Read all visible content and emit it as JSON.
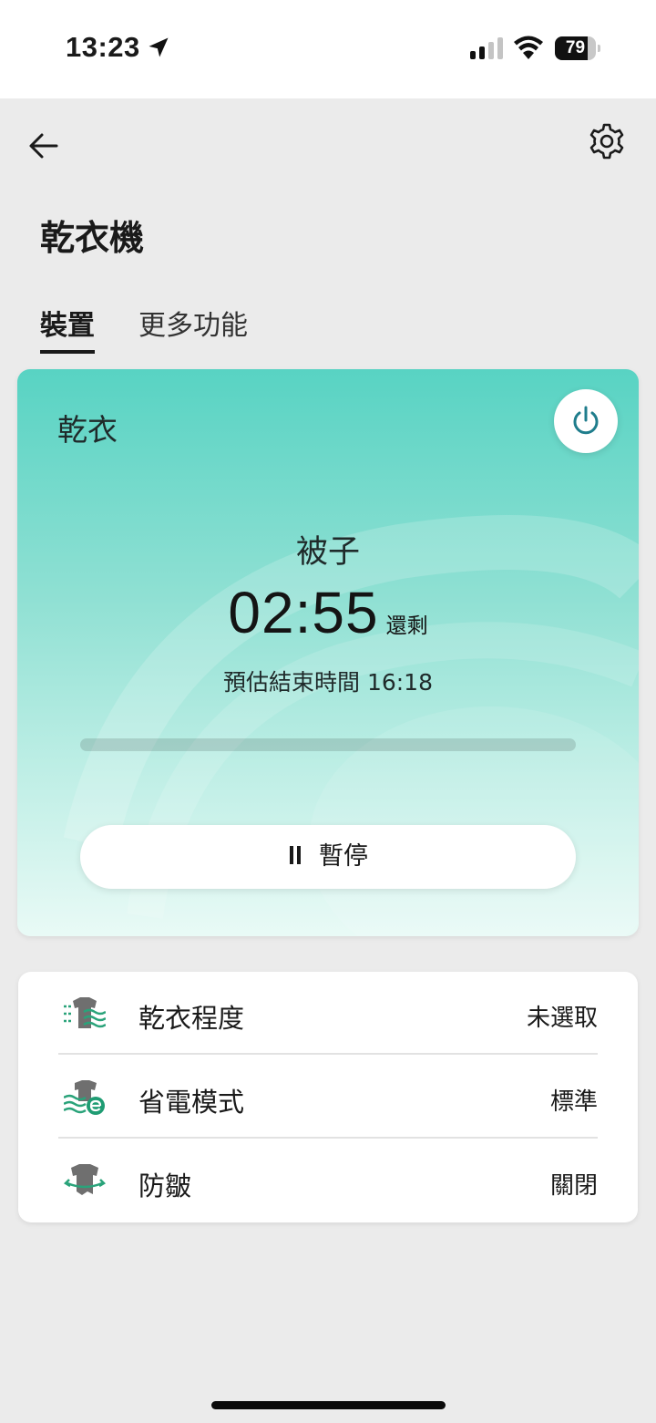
{
  "status_bar": {
    "time": "13:23",
    "battery_level": "79",
    "battery_fraction": 0.79
  },
  "header": {
    "title": "乾衣機",
    "back_icon": "arrow-left-icon",
    "settings_icon": "gear-icon"
  },
  "tabs": [
    {
      "label": "裝置",
      "active": true
    },
    {
      "label": "更多功能",
      "active": false
    }
  ],
  "cycle": {
    "mode": "乾衣",
    "program": "被子",
    "time_remaining": "02:55",
    "time_suffix": "還剩",
    "end_time_text": "預估結束時間 16:18",
    "progress_fraction": 0,
    "pause_label": "暫停",
    "power_icon": "power-icon",
    "accent_color": "#1f8a8a"
  },
  "settings": [
    {
      "icon": "drying-level-icon",
      "label": "乾衣程度",
      "value": "未選取"
    },
    {
      "icon": "eco-mode-icon",
      "label": "省電模式",
      "value": "標準"
    },
    {
      "icon": "anti-crease-icon",
      "label": "防皺",
      "value": "關閉"
    }
  ]
}
